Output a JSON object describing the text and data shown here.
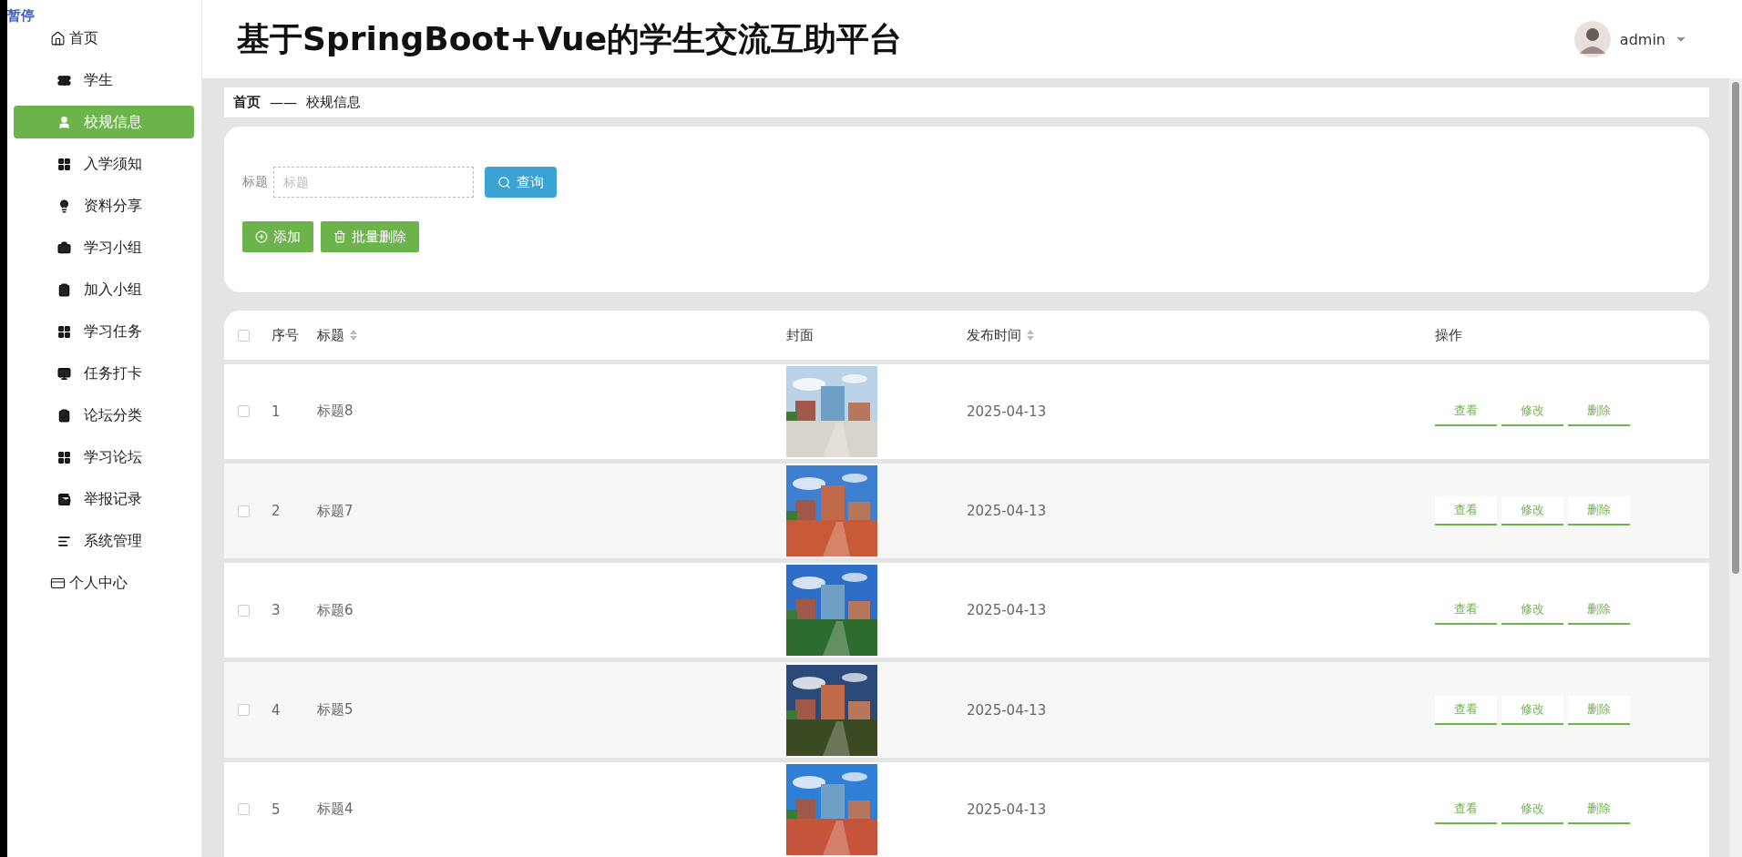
{
  "recorder_label": "暂停",
  "sidebar": {
    "items": [
      {
        "label": "首页",
        "selected": false,
        "top_level": true
      },
      {
        "label": "学生",
        "selected": false,
        "top_level": false
      },
      {
        "label": "校规信息",
        "selected": true,
        "top_level": false
      },
      {
        "label": "入学须知",
        "selected": false,
        "top_level": false
      },
      {
        "label": "资料分享",
        "selected": false,
        "top_level": false
      },
      {
        "label": "学习小组",
        "selected": false,
        "top_level": false
      },
      {
        "label": "加入小组",
        "selected": false,
        "top_level": false
      },
      {
        "label": "学习任务",
        "selected": false,
        "top_level": false
      },
      {
        "label": "任务打卡",
        "selected": false,
        "top_level": false
      },
      {
        "label": "论坛分类",
        "selected": false,
        "top_level": false
      },
      {
        "label": "学习论坛",
        "selected": false,
        "top_level": false
      },
      {
        "label": "举报记录",
        "selected": false,
        "top_level": false
      },
      {
        "label": "系统管理",
        "selected": false,
        "top_level": false
      },
      {
        "label": "个人中心",
        "selected": false,
        "top_level": true
      }
    ]
  },
  "header": {
    "title": "基于SpringBoot+Vue的学生交流互助平台",
    "user": "admin"
  },
  "breadcrumb": {
    "home": "首页",
    "separator": "——",
    "current": "校规信息"
  },
  "search": {
    "label": "标题",
    "placeholder": "标题",
    "button": "查询"
  },
  "actions": [
    {
      "label": "添加",
      "kind": "add"
    },
    {
      "label": "批量删除",
      "kind": "delete"
    }
  ],
  "table": {
    "select_all_checked": false,
    "columns": [
      {
        "label": "序号",
        "sortable": false
      },
      {
        "label": "标题",
        "sortable": true
      },
      {
        "label": "封面",
        "sortable": false
      },
      {
        "label": "发布时间",
        "sortable": true
      },
      {
        "label": "操作",
        "sortable": false
      }
    ],
    "rows": [
      {
        "checked": false,
        "index": "1",
        "title": "标题8",
        "date": "2025-04-13",
        "buttons": [
          "查看",
          "修改",
          "删除"
        ]
      },
      {
        "checked": false,
        "index": "2",
        "title": "标题7",
        "date": "2025-04-13",
        "buttons": [
          "查看",
          "修改",
          "删除"
        ]
      },
      {
        "checked": false,
        "index": "3",
        "title": "标题6",
        "date": "2025-04-13",
        "buttons": [
          "查看",
          "修改",
          "删除"
        ]
      },
      {
        "checked": false,
        "index": "4",
        "title": "标题5",
        "date": "2025-04-13",
        "buttons": [
          "查看",
          "修改",
          "删除"
        ]
      },
      {
        "checked": false,
        "index": "5",
        "title": "标题4",
        "date": "2025-04-13",
        "buttons": [
          "查看",
          "修改",
          "删除"
        ]
      }
    ]
  }
}
